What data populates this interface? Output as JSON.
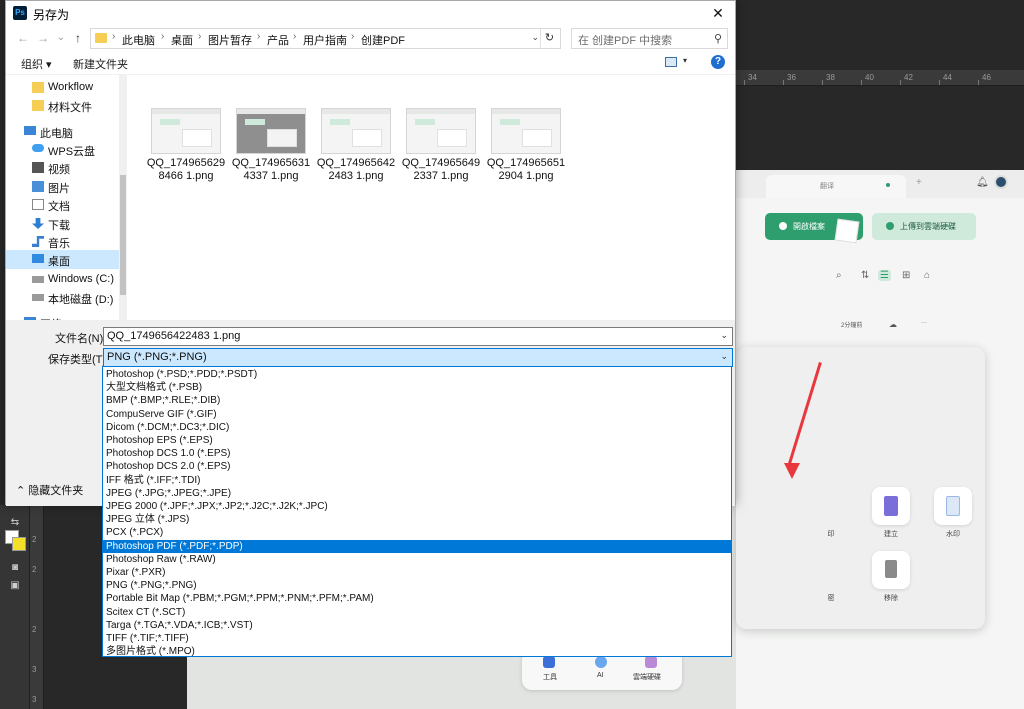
{
  "dialog": {
    "title": "另存为",
    "close": "✕",
    "nav": {
      "back": "←",
      "forward": "→",
      "down": "⌄",
      "up": "↑"
    },
    "breadcrumb": [
      "此电脑",
      "桌面",
      "图片暂存",
      "产品",
      "用户指南",
      "创建PDF"
    ],
    "breadcrumb_sep": "›",
    "refresh": "↻",
    "search_placeholder": "在 创建PDF 中搜索",
    "toolbar": {
      "organize": "组织 ▾",
      "new_folder": "新建文件夹",
      "view_dropdown": "▾",
      "help": "?"
    },
    "sidebar": [
      {
        "label": "Workflow",
        "icon": "folder-icon"
      },
      {
        "label": "材料文件",
        "icon": "folder-icon"
      },
      {
        "label": "此电脑",
        "icon": "computer-icon"
      },
      {
        "label": "WPS云盘",
        "icon": "cloud-icon"
      },
      {
        "label": "视频",
        "icon": "video-icon"
      },
      {
        "label": "图片",
        "icon": "picture-icon"
      },
      {
        "label": "文档",
        "icon": "document-icon"
      },
      {
        "label": "下载",
        "icon": "download-icon"
      },
      {
        "label": "音乐",
        "icon": "music-icon"
      },
      {
        "label": "桌面",
        "icon": "desktop-icon"
      },
      {
        "label": "Windows (C:)",
        "icon": "drive-icon"
      },
      {
        "label": "本地磁盘 (D:)",
        "icon": "drive-icon"
      },
      {
        "label": "网络",
        "icon": "network-icon"
      }
    ],
    "files": [
      {
        "line1": "QQ_174965629",
        "line2": "8466 1.png"
      },
      {
        "line1": "QQ_174965631",
        "line2": "4337 1.png"
      },
      {
        "line1": "QQ_174965642",
        "line2": "2483 1.png"
      },
      {
        "line1": "QQ_174965649",
        "line2": "2337 1.png"
      },
      {
        "line1": "QQ_174965651",
        "line2": "2904 1.png"
      }
    ],
    "filename_label": "文件名(N):",
    "filename_value": "QQ_1749656422483 1.png",
    "filetype_label": "保存类型(T):",
    "filetype_value": "PNG (*.PNG;*.PNG)",
    "dropdown_arrow": "⌄",
    "hide_folders": "⌃  隐藏文件夹",
    "filetype_options": [
      "Photoshop (*.PSD;*.PDD;*.PSDT)",
      "大型文档格式 (*.PSB)",
      "BMP (*.BMP;*.RLE;*.DIB)",
      "CompuServe GIF (*.GIF)",
      "Dicom (*.DCM;*.DC3;*.DIC)",
      "Photoshop EPS (*.EPS)",
      "Photoshop DCS 1.0 (*.EPS)",
      "Photoshop DCS 2.0 (*.EPS)",
      "IFF 格式 (*.IFF;*.TDI)",
      "JPEG (*.JPG;*.JPEG;*.JPE)",
      "JPEG 2000 (*.JPF;*.JPX;*.JP2;*.J2C;*.J2K;*.JPC)",
      "JPEG 立体 (*.JPS)",
      "PCX (*.PCX)",
      "Photoshop PDF (*.PDF;*.PDP)",
      "Photoshop Raw (*.RAW)",
      "Pixar (*.PXR)",
      "PNG (*.PNG;*.PNG)",
      "Portable Bit Map (*.PBM;*.PGM;*.PPM;*.PNM;*.PFM;*.PAM)",
      "Scitex CT (*.SCT)",
      "Targa (*.TGA;*.VDA;*.ICB;*.VST)",
      "TIFF (*.TIF;*.TIFF)",
      "多图片格式 (*.MPO)"
    ],
    "selected_option_index": 13
  },
  "photoshop": {
    "ruler_top": [
      "34",
      "36",
      "38",
      "40",
      "42",
      "44",
      "46"
    ],
    "ruler_left": [
      "2",
      "2",
      "2",
      "3",
      "3"
    ],
    "fg_color": "#ffffff",
    "bg_color": "#f2e02b"
  },
  "canvas_app": {
    "tab_title": "翻译",
    "tab_plus": "+",
    "open_file_button": "開啟檔案",
    "upload_cloud_button": "上傳到雲端硬碟",
    "file_time": "2分鐘前",
    "more": "···",
    "tool_labels": [
      "印",
      "建立",
      "水印",
      "密",
      "移除"
    ],
    "bottom_bar": [
      "工具",
      "AI",
      "雲端硬碟"
    ],
    "accent_color": "#2f9e6e",
    "arrow_color": "#e8383d"
  }
}
